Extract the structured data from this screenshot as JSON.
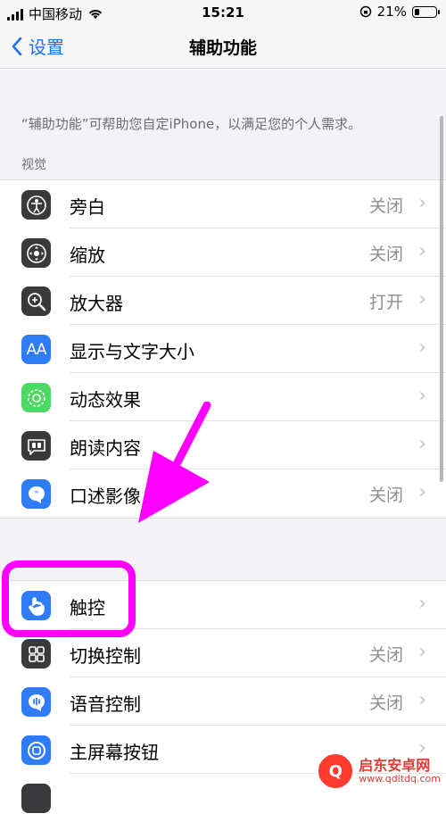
{
  "status_bar": {
    "carrier": "中国移动",
    "time": "15:21",
    "battery": "21%"
  },
  "nav": {
    "back_label": "设置",
    "title": "辅助功能"
  },
  "intro_text": "“辅助功能”可帮助您自定iPhone，以满足您的个人需求。",
  "vision": {
    "header": "视觉",
    "items": [
      {
        "label": "旁白",
        "value": "关闭",
        "icon": "voiceover-icon",
        "color": "#3a3a3c"
      },
      {
        "label": "缩放",
        "value": "关闭",
        "icon": "zoom-icon",
        "color": "#3a3a3c"
      },
      {
        "label": "放大器",
        "value": "打开",
        "icon": "magnifier-icon",
        "color": "#3a3a3c"
      },
      {
        "label": "显示与文字大小",
        "value": "",
        "icon": "text-size-icon",
        "color": "#2f7cf6"
      },
      {
        "label": "动态效果",
        "value": "",
        "icon": "motion-icon",
        "color": "#4cd964"
      },
      {
        "label": "朗读内容",
        "value": "",
        "icon": "spoken-content-icon",
        "color": "#3a3a3c"
      },
      {
        "label": "口述影像",
        "value": "关闭",
        "icon": "audio-description-icon",
        "color": "#2f7cf6"
      }
    ]
  },
  "physical": {
    "items": [
      {
        "label": "触控",
        "value": "",
        "icon": "touch-icon",
        "color": "#2f7cf6"
      },
      {
        "label": "切换控制",
        "value": "关闭",
        "icon": "switch-control-icon",
        "color": "#3a3a3c"
      },
      {
        "label": "语音控制",
        "value": "关闭",
        "icon": "voice-control-icon",
        "color": "#2f7cf6"
      },
      {
        "label": "主屏幕按钮",
        "value": "",
        "icon": "home-button-icon",
        "color": "#2f7cf6"
      }
    ]
  },
  "watermark": {
    "name": "启东安卓网",
    "url": "www.qdltdq.com"
  },
  "colors": {
    "accent": "#1a73e8",
    "annotation": "#ff00ff"
  }
}
